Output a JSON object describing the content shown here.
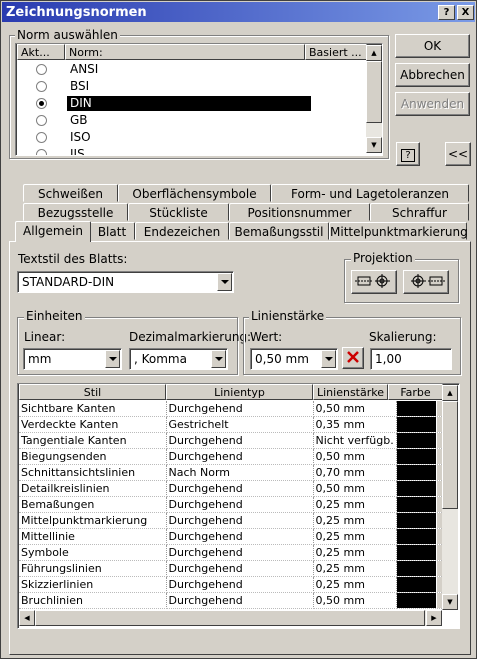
{
  "window": {
    "title": "Zeichnungsnormen",
    "help_glyph": "?",
    "close_glyph": "X"
  },
  "buttons": {
    "ok": "OK",
    "cancel": "Abbrechen",
    "apply": "Anwenden",
    "help_glyph": "?",
    "collapse": "<<"
  },
  "standard_select": {
    "group_label": "Norm auswählen",
    "columns": [
      "Akt...",
      "Norm:",
      "Basiert ..."
    ],
    "items": [
      {
        "name": "ANSI",
        "active": false,
        "selected": false
      },
      {
        "name": "BSI",
        "active": false,
        "selected": false
      },
      {
        "name": "DIN",
        "active": true,
        "selected": true
      },
      {
        "name": "GB",
        "active": false,
        "selected": false
      },
      {
        "name": "ISO",
        "active": false,
        "selected": false
      },
      {
        "name": "JIS",
        "active": false,
        "selected": false
      }
    ]
  },
  "tabs": {
    "row1": [
      "Schweißen",
      "Oberflächensymbole",
      "Form- und Lagetoleranzen"
    ],
    "row2": [
      "Bezugsstelle",
      "Stückliste",
      "Positionsnummer",
      "Schraffur"
    ],
    "row3": [
      "Allgemein",
      "Blatt",
      "Endezeichen",
      "Bemaßungsstil",
      "Mittelpunktmarkierung"
    ],
    "active": "Allgemein"
  },
  "sheet_text_style": {
    "label": "Textstil des Blatts:",
    "value": "STANDARD-DIN"
  },
  "projection": {
    "label": "Projektion"
  },
  "units": {
    "label": "Einheiten",
    "linear_label": "Linear:",
    "linear_value": "mm",
    "decimal_label": "Dezimalmarkierung:",
    "decimal_value": ", Komma"
  },
  "lineweight": {
    "label": "Linienstärke",
    "value_label": "Wert:",
    "value": "0,50 mm",
    "scale_label": "Skalierung:",
    "scale_value": "1,00"
  },
  "layers": {
    "columns": [
      "Stil",
      "Linientyp",
      "Linienstärke",
      "Farbe"
    ],
    "rows": [
      {
        "style": "Sichtbare Kanten",
        "linetype": "Durchgehend",
        "weight": "0,50 mm",
        "color": "#000000"
      },
      {
        "style": "Verdeckte Kanten",
        "linetype": "Gestrichelt",
        "weight": "0,35 mm",
        "color": "#000000"
      },
      {
        "style": "Tangentiale Kanten",
        "linetype": "Durchgehend",
        "weight": "Nicht verfügb.",
        "color": "#000000"
      },
      {
        "style": "Biegungsenden",
        "linetype": "Durchgehend",
        "weight": "0,50 mm",
        "color": "#000000"
      },
      {
        "style": "Schnittansichtslinien",
        "linetype": "Nach Norm",
        "weight": "0,70 mm",
        "color": "#000000"
      },
      {
        "style": "Detailkreislinien",
        "linetype": "Durchgehend",
        "weight": "0,50 mm",
        "color": "#000000"
      },
      {
        "style": "Bemaßungen",
        "linetype": "Durchgehend",
        "weight": "0,25 mm",
        "color": "#000000"
      },
      {
        "style": "Mittelpunktmarkierung",
        "linetype": "Durchgehend",
        "weight": "0,25 mm",
        "color": "#000000"
      },
      {
        "style": "Mittellinie",
        "linetype": "Durchgehend",
        "weight": "0,25 mm",
        "color": "#000000"
      },
      {
        "style": "Symbole",
        "linetype": "Durchgehend",
        "weight": "0,25 mm",
        "color": "#000000"
      },
      {
        "style": "Führungslinien",
        "linetype": "Durchgehend",
        "weight": "0,25 mm",
        "color": "#000000"
      },
      {
        "style": "Skizzierlinien",
        "linetype": "Durchgehend",
        "weight": "0,25 mm",
        "color": "#000000"
      },
      {
        "style": "Bruchlinien",
        "linetype": "Durchgehend",
        "weight": "0,50 mm",
        "color": "#000000"
      }
    ]
  },
  "colors": {
    "title_start": "#2a3bb0",
    "title_end": "#7a9ae6",
    "selection": "#000000",
    "dialog": "#d4d0c8",
    "delete_red": "#cc0000"
  }
}
